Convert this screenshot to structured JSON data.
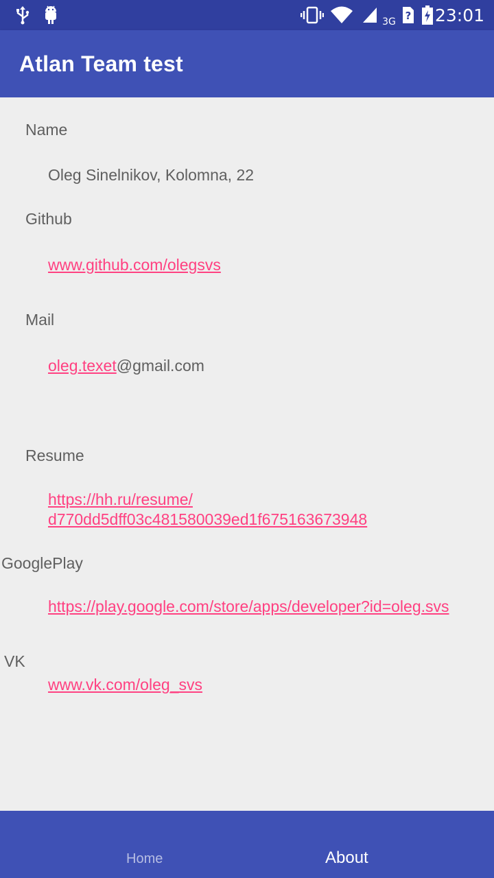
{
  "status_bar": {
    "time": "23:01",
    "network": "3G",
    "icons": [
      "usb-icon",
      "android-debug-icon",
      "vibrate-icon",
      "wifi-icon",
      "signal-icon",
      "sim-unknown-icon",
      "battery-charging-icon"
    ]
  },
  "app_bar": {
    "title": "Atlan Team test"
  },
  "profile": {
    "name_label": "Name",
    "name_value": "Oleg Sinelnikov, Kolomna, 22",
    "github_label": "Github",
    "github_value": "www.github.com/olegsvs",
    "mail_label": "Mail",
    "mail_link_part": "oleg.texet",
    "mail_plain_part": "@gmail.com",
    "resume_label": "Resume",
    "resume_value_line1": "https://hh.ru/resume/",
    "resume_value_line2": "d770dd5dff03c481580039ed1f675163673948",
    "googleplay_label": "GooglePlay",
    "googleplay_value": "https://play.google.com/store/apps/developer?id=oleg.svs",
    "vk_label": "VK",
    "vk_value": "www.vk.com/oleg_svs"
  },
  "bottom_nav": {
    "home_label": "Home",
    "about_label": "About",
    "selected": "About"
  },
  "colors": {
    "status_bar": "#303F9F",
    "primary": "#3F51B5",
    "accent_link": "#FF4081",
    "background": "#EEEEEE",
    "text": "#5F5F5F"
  }
}
